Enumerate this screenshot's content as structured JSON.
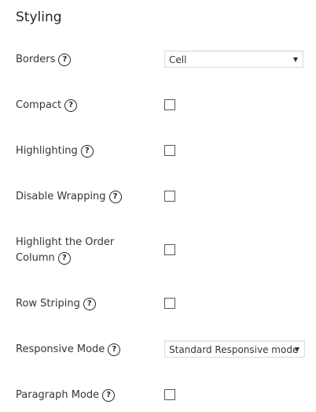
{
  "section": {
    "title": "Styling"
  },
  "help_glyph": "?",
  "fields": {
    "borders": {
      "label": "Borders",
      "type": "select",
      "value": "Cell"
    },
    "compact": {
      "label": "Compact",
      "type": "checkbox",
      "checked": false
    },
    "highlighting": {
      "label": "Highlighting",
      "type": "checkbox",
      "checked": false
    },
    "disable_wrapping": {
      "label": "Disable Wrapping",
      "type": "checkbox",
      "checked": false
    },
    "highlight_order_column": {
      "label_line1": "Highlight the Order",
      "label_line2": "Column",
      "type": "checkbox",
      "checked": false
    },
    "row_striping": {
      "label": "Row Striping",
      "type": "checkbox",
      "checked": false
    },
    "responsive_mode": {
      "label": "Responsive Mode",
      "type": "select",
      "value": "Standard Responsive mode"
    },
    "paragraph_mode": {
      "label": "Paragraph Mode",
      "type": "checkbox",
      "checked": false
    }
  },
  "icons": {
    "help": "help-question-icon",
    "dropdown": "caret-down-icon"
  },
  "caret_glyph": "▼"
}
